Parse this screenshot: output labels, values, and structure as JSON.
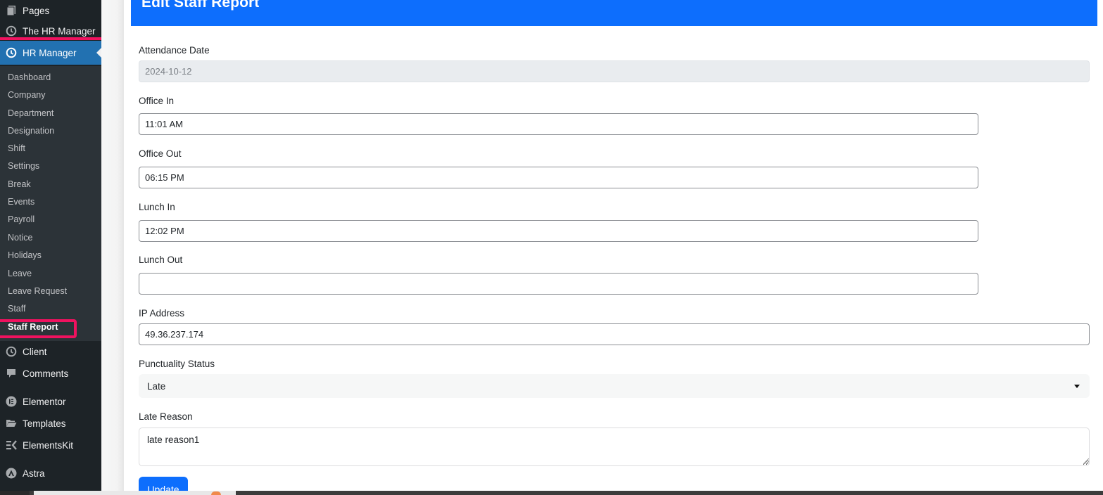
{
  "sidebar": {
    "top_items": [
      {
        "label": "Pages",
        "icon": "pages-icon"
      },
      {
        "label": "The HR Manager",
        "icon": "clock-icon"
      }
    ],
    "active_item": {
      "label": "HR Manager",
      "icon": "clock-icon"
    },
    "submenu": [
      {
        "label": "Dashboard"
      },
      {
        "label": "Company"
      },
      {
        "label": "Department"
      },
      {
        "label": "Designation"
      },
      {
        "label": "Shift"
      },
      {
        "label": "Settings"
      },
      {
        "label": "Break"
      },
      {
        "label": "Events"
      },
      {
        "label": "Payroll"
      },
      {
        "label": "Notice"
      },
      {
        "label": "Holidays"
      },
      {
        "label": "Leave"
      },
      {
        "label": "Leave Request"
      },
      {
        "label": "Staff"
      },
      {
        "label": "Staff Report",
        "current": true
      }
    ],
    "bottom_items": [
      {
        "label": "Client",
        "icon": "clock-icon"
      },
      {
        "label": "Comments",
        "icon": "comment-icon"
      },
      {
        "label": "Elementor",
        "icon": "elementor-icon"
      },
      {
        "label": "Templates",
        "icon": "folder-icon"
      },
      {
        "label": "ElementsKit",
        "icon": "elementskit-icon"
      },
      {
        "label": "Astra",
        "icon": "astra-icon"
      }
    ],
    "colors": {
      "background": "#1d2327",
      "submenu_background": "#2c3338",
      "active": "#2271b1",
      "highlight": "#f0125f"
    }
  },
  "page": {
    "title": "Edit Staff Report",
    "header_color": "#0d6efd"
  },
  "form": {
    "attendance_date": {
      "label": "Attendance Date",
      "value": "2024-10-12",
      "disabled": true
    },
    "office_in": {
      "label": "Office In",
      "value": "11:01 AM"
    },
    "office_out": {
      "label": "Office Out",
      "value": "06:15 PM"
    },
    "lunch_in": {
      "label": "Lunch In",
      "value": "12:02 PM"
    },
    "lunch_out": {
      "label": "Lunch Out",
      "value": ""
    },
    "ip_address": {
      "label": "IP Address",
      "value": "49.36.237.174"
    },
    "punctuality_status": {
      "label": "Punctuality Status",
      "value": "Late"
    },
    "late_reason": {
      "label": "Late Reason",
      "value": "late reason1"
    },
    "submit_label": "Update"
  }
}
